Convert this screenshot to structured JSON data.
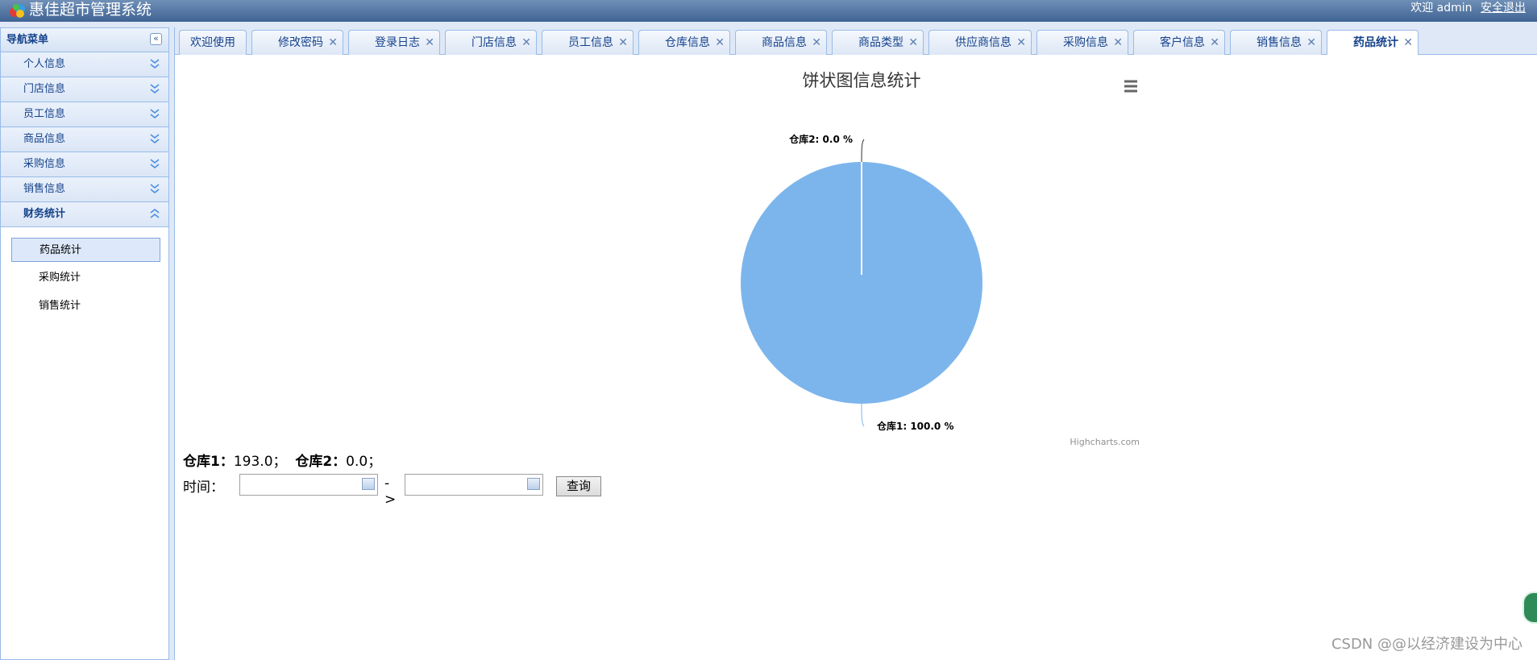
{
  "header": {
    "title": "惠佳超市管理系统",
    "welcome": "欢迎 admin",
    "logout": "安全退出"
  },
  "sidebar": {
    "title": "导航菜单",
    "items": [
      {
        "label": "个人信息"
      },
      {
        "label": "门店信息"
      },
      {
        "label": "员工信息"
      },
      {
        "label": "商品信息"
      },
      {
        "label": "采购信息"
      },
      {
        "label": "销售信息"
      },
      {
        "label": "财务统计"
      }
    ],
    "sub_items": [
      {
        "label": "药品统计"
      },
      {
        "label": "采购统计"
      },
      {
        "label": "销售统计"
      }
    ]
  },
  "tabs": [
    {
      "label": "欢迎使用"
    },
    {
      "label": "修改密码"
    },
    {
      "label": "登录日志"
    },
    {
      "label": "门店信息"
    },
    {
      "label": "员工信息"
    },
    {
      "label": "仓库信息"
    },
    {
      "label": "商品信息"
    },
    {
      "label": "商品类型"
    },
    {
      "label": "供应商信息"
    },
    {
      "label": "采购信息"
    },
    {
      "label": "客户信息"
    },
    {
      "label": "销售信息"
    },
    {
      "label": "药品统计"
    }
  ],
  "chart_data": {
    "type": "pie",
    "title": "饼状图信息统计",
    "slices": [
      {
        "name": "仓库1",
        "value": 193.0,
        "percent_label": "仓库1: 100.0 %"
      },
      {
        "name": "仓库2",
        "value": 0.0,
        "percent_label": "仓库2: 0.0 %"
      }
    ],
    "color": "#7cb5ec",
    "credits": "Highcharts.com"
  },
  "stats": {
    "w1_label": "仓库1：",
    "w1_value": "193.0；",
    "w2_label": "仓库2：",
    "w2_value": "0.0；"
  },
  "filter": {
    "time_label": "时间：",
    "arrow": "->",
    "query_button": "查询"
  },
  "watermark": "CSDN @@以经济建设为中心"
}
